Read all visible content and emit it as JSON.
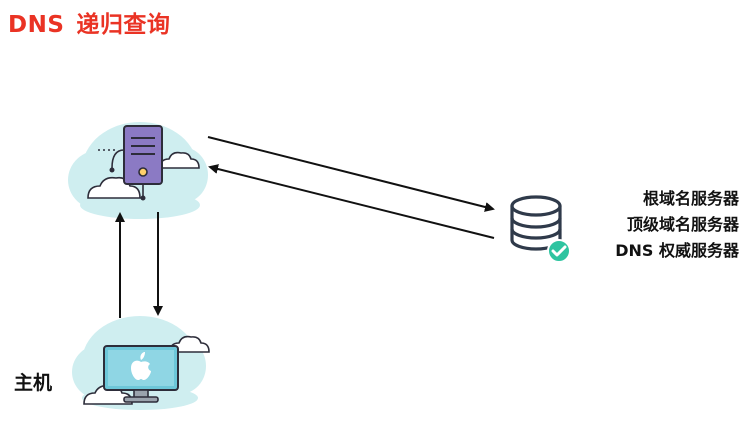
{
  "title": {
    "prefix": "DNS",
    "text": "递归查询",
    "color": "#ea3324"
  },
  "nodes": {
    "local_dns": {
      "icon": "server-tower-in-cloud-icon",
      "label": ""
    },
    "host": {
      "icon": "apple-monitor-in-cloud-icon",
      "label": "主机"
    },
    "remote_servers": {
      "icon": "database-check-icon",
      "labels": [
        "根域名服务器",
        "顶级域名服务器",
        "DNS 权威服务器"
      ]
    }
  },
  "arrows": [
    {
      "from": "local_dns",
      "to": "remote_servers",
      "direction": "request"
    },
    {
      "from": "remote_servers",
      "to": "local_dns",
      "direction": "response"
    },
    {
      "from": "host",
      "to": "local_dns",
      "direction": "request"
    },
    {
      "from": "local_dns",
      "to": "host",
      "direction": "response"
    }
  ],
  "colors": {
    "cloud": "#cfeef0",
    "server_body": "#8b7ac4",
    "outline": "#2d2d3a",
    "screen": "#6dc7d9",
    "database": "#2f3a4a",
    "check": "#2ec4a0",
    "arrow": "#111111"
  }
}
